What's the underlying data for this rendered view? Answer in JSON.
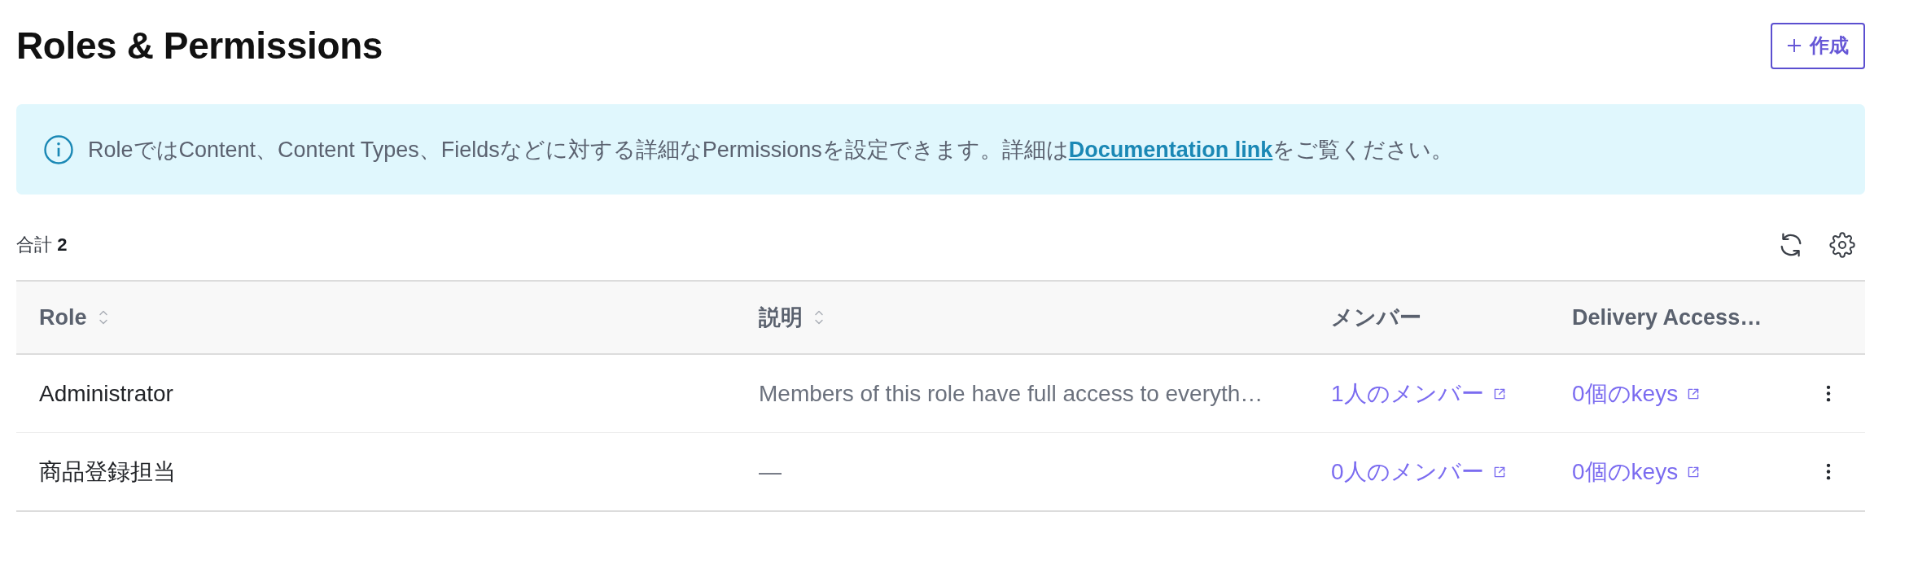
{
  "page": {
    "title": "Roles & Permissions",
    "create_button": "作成"
  },
  "info_banner": {
    "text_before": "RoleではContent、Content Types、Fieldsなどに対する詳細なPermissionsを設定できます。詳細は",
    "link": "Documentation link",
    "text_after": "をご覧ください。"
  },
  "toolbar": {
    "total": "合計 **2**"
  },
  "table": {
    "columns": [
      {
        "label": "Role",
        "sortable": true
      },
      {
        "label": "説明",
        "sortable": true
      },
      {
        "label": "メンバー",
        "sortable": false
      },
      {
        "label": "Delivery Access…",
        "sortable": false
      }
    ],
    "rows": [
      {
        "role": "Administrator",
        "description": "Members of this role have full access to everyth…",
        "members": "1人のメンバー",
        "keys": "0個のkeys"
      },
      {
        "role": "商品登録担当",
        "description": "—",
        "members": "0人のメンバー",
        "keys": "0個のkeys"
      }
    ]
  }
}
